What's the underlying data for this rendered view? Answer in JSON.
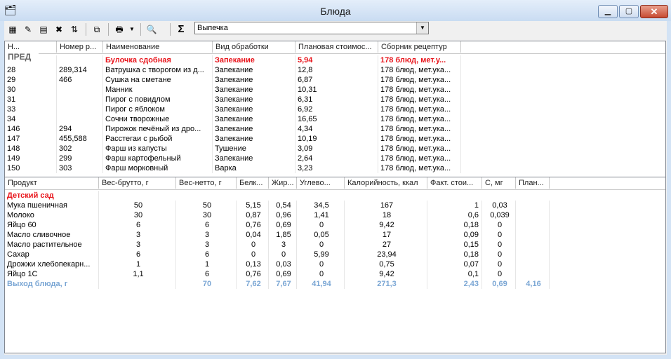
{
  "window": {
    "title": "Блюда"
  },
  "toolbar": {
    "filter_value": "Выпечка",
    "sum_icon": "Σ"
  },
  "overlay_label": "ПРЕД",
  "dishes": {
    "columns": [
      "Н...",
      "Номер р...",
      "Наименование",
      "Вид обработки",
      "Плановая стоимос...",
      "Сборник рецептур"
    ],
    "rows": [
      {
        "num": "",
        "recipe": "",
        "name": "Булочка сдобная",
        "process": "Запекание",
        "cost": "5,94",
        "book": "178 блюд, мет.у...",
        "selected": true
      },
      {
        "num": "28",
        "recipe": "289,314",
        "name": "Ватрушка с творогом из д...",
        "process": "Запекание",
        "cost": "12,8",
        "book": "178 блюд, мет.ука..."
      },
      {
        "num": "29",
        "recipe": "466",
        "name": "Сушка на сметане",
        "process": "Запекание",
        "cost": "6,87",
        "book": "178 блюд, мет.ука..."
      },
      {
        "num": "30",
        "recipe": "",
        "name": "Манник",
        "process": "Запекание",
        "cost": "10,31",
        "book": "178 блюд, мет.ука..."
      },
      {
        "num": "31",
        "recipe": "",
        "name": "Пирог с повидлом",
        "process": "Запекание",
        "cost": "6,31",
        "book": "178 блюд, мет.ука..."
      },
      {
        "num": "33",
        "recipe": "",
        "name": "Пирог с яблоком",
        "process": "Запекание",
        "cost": "6,92",
        "book": "178 блюд, мет.ука..."
      },
      {
        "num": "34",
        "recipe": "",
        "name": "Сочни творожные",
        "process": "Запекание",
        "cost": "16,65",
        "book": "178 блюд, мет.ука..."
      },
      {
        "num": "146",
        "recipe": "294",
        "name": "Пирожок печёный из дро...",
        "process": "Запекание",
        "cost": "4,34",
        "book": "178 блюд, мет.ука..."
      },
      {
        "num": "147",
        "recipe": "455,588",
        "name": "Расстегаи с рыбой",
        "process": "Запекание",
        "cost": "10,19",
        "book": "178 блюд, мет.ука..."
      },
      {
        "num": "148",
        "recipe": "302",
        "name": "Фарш из капусты",
        "process": "Тушение",
        "cost": "3,09",
        "book": "178 блюд, мет.ука..."
      },
      {
        "num": "149",
        "recipe": "299",
        "name": "Фарш картофельный",
        "process": "Запекание",
        "cost": "2,64",
        "book": "178 блюд, мет.ука..."
      },
      {
        "num": "150",
        "recipe": "303",
        "name": "Фарш морковный",
        "process": "Варка",
        "cost": "3,23",
        "book": "178 блюд, мет.ука..."
      }
    ]
  },
  "products": {
    "columns": [
      "Продукт",
      "Вес-брутто, г",
      "Вес-нетто, г",
      "Белк...",
      "Жир...",
      "Углево...",
      "Калорийность, ккал",
      "Факт. стои...",
      "С, мг",
      "План..."
    ],
    "group": "Детский сад",
    "rows": [
      [
        "Мука пшеничная",
        "50",
        "50",
        "5,15",
        "0,54",
        "34,5",
        "167",
        "1",
        "0,03",
        ""
      ],
      [
        "Молоко",
        "30",
        "30",
        "0,87",
        "0,96",
        "1,41",
        "18",
        "0,6",
        "0,039",
        ""
      ],
      [
        "Яйцо 60",
        "6",
        "6",
        "0,76",
        "0,69",
        "0",
        "9,42",
        "0,18",
        "0",
        ""
      ],
      [
        "Масло сливочное",
        "3",
        "3",
        "0,04",
        "1,85",
        "0,05",
        "17",
        "0,09",
        "0",
        ""
      ],
      [
        "Масло растительное",
        "3",
        "3",
        "0",
        "3",
        "0",
        "27",
        "0,15",
        "0",
        ""
      ],
      [
        "Сахар",
        "6",
        "6",
        "0",
        "0",
        "5,99",
        "23,94",
        "0,18",
        "0",
        ""
      ],
      [
        "Дрожжи хлебопекарн...",
        "1",
        "1",
        "0,13",
        "0,03",
        "0",
        "0,75",
        "0,07",
        "0",
        ""
      ],
      [
        "Яйцо 1С",
        "1,1",
        "6",
        "0,76",
        "0,69",
        "0",
        "9,42",
        "0,1",
        "0",
        ""
      ]
    ],
    "total": [
      "Выход блюда, г",
      "",
      "70",
      "7,62",
      "7,67",
      "41,94",
      "271,3",
      "2,43",
      "0,69",
      "4,16"
    ]
  }
}
